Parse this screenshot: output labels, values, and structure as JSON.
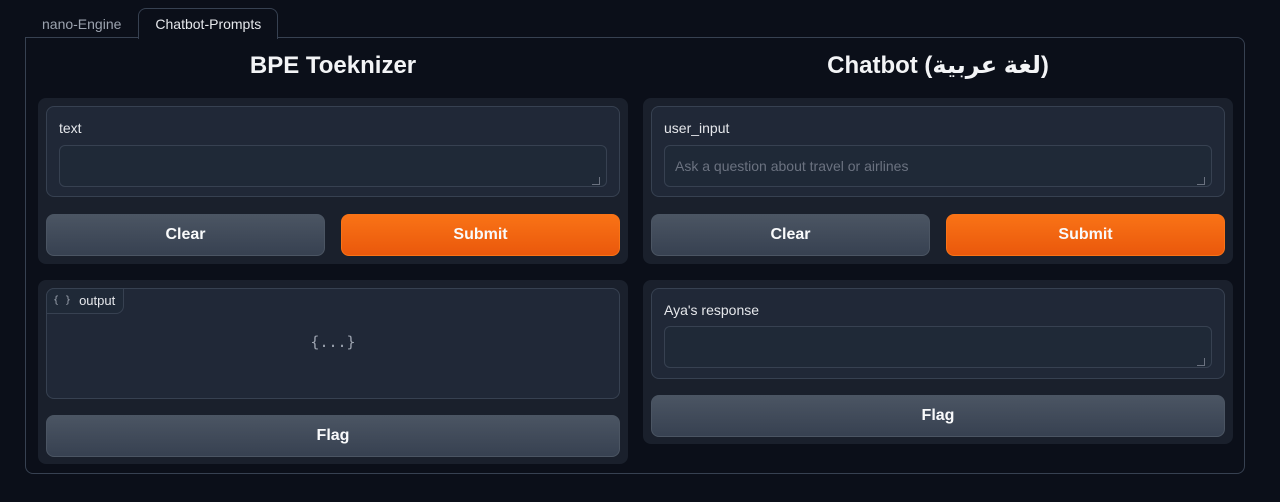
{
  "tabs": [
    {
      "label": "nano-Engine",
      "active": false
    },
    {
      "label": "Chatbot-Prompts",
      "active": true
    }
  ],
  "left": {
    "title": "BPE Toeknizer",
    "input": {
      "label": "text",
      "value": "",
      "placeholder": ""
    },
    "clear_label": "Clear",
    "submit_label": "Submit",
    "output": {
      "label": "output",
      "icon": "json-icon",
      "placeholder_glyph": "{...}"
    },
    "flag_label": "Flag"
  },
  "right": {
    "title": "Chatbot (لغة عربية)",
    "input": {
      "label": "user_input",
      "value": "",
      "placeholder": "Ask a question about travel or airlines"
    },
    "clear_label": "Clear",
    "submit_label": "Submit",
    "output": {
      "label": "Aya's response",
      "value": ""
    },
    "flag_label": "Flag"
  },
  "colors": {
    "background": "#0b0f19",
    "card": "#1a202c",
    "field": "#202837",
    "primary": "#f97316",
    "secondary": "#4b5563",
    "border": "#374151"
  }
}
